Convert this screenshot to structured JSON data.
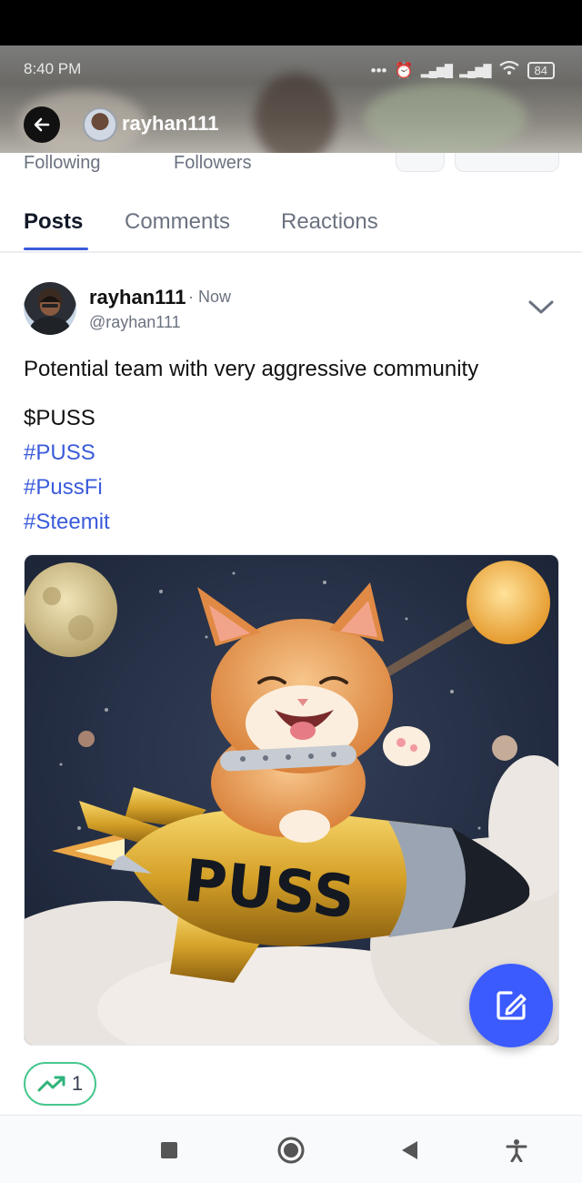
{
  "status_bar": {
    "time": "8:40 PM",
    "battery": "84"
  },
  "header": {
    "username": "rayhan111"
  },
  "profile_stats": {
    "following_label": "Following",
    "followers_label": "Followers"
  },
  "tabs": [
    {
      "label": "Posts",
      "active": true
    },
    {
      "label": "Comments",
      "active": false
    },
    {
      "label": "Reactions",
      "active": false
    }
  ],
  "post": {
    "author": "rayhan111",
    "time": "· Now",
    "handle": "@rayhan111",
    "text": "Potential team with very aggressive community",
    "cashtag": "$PUSS",
    "hashtags": [
      "#PUSS",
      "#PussFi",
      "#Steemit"
    ],
    "image_text": "PUSS",
    "trend_count": "1"
  },
  "colors": {
    "accent": "#3b5bdb",
    "fab": "#3b5bff",
    "trend_green": "#48c78e"
  },
  "icons": {
    "back": "arrow-left-icon",
    "chevron": "chevron-down-icon",
    "fab": "compose-icon",
    "trend": "trending-up-icon",
    "nav_recent": "square-icon",
    "nav_home": "circle-icon",
    "nav_back": "triangle-back-icon",
    "nav_accessibility": "accessibility-icon"
  }
}
